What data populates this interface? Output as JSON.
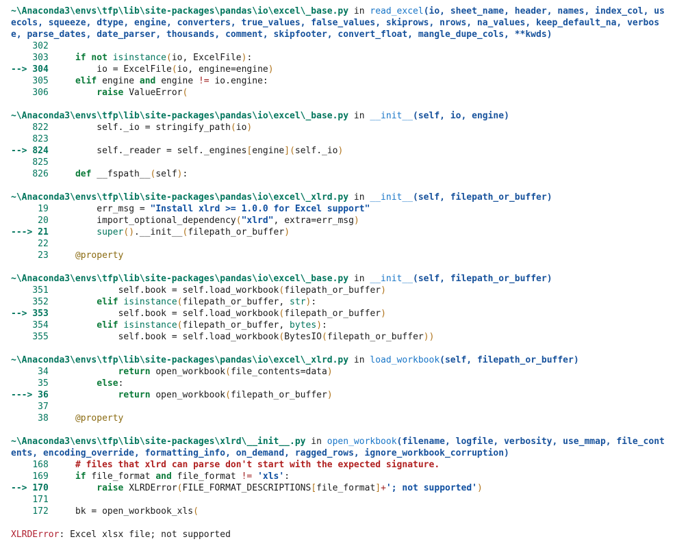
{
  "frames": [
    {
      "path": "~\\Anaconda3\\envs\\tfp\\lib\\site-packages\\pandas\\io\\excel\\_base.py",
      "in_word": "in",
      "func": "read_excel",
      "args": "(io, sheet_name, header, names, index_col, usecols, squeeze, dtype, engine, converters, true_values, false_values, skiprows, nrows, na_values, keep_default_na, verbose, parse_dates, date_parser, thousands, comment, skipfooter, convert_float, mangle_dupe_cols, **kwds)",
      "lines": [
        {
          "marker": "    ",
          "num": "302",
          "code": ""
        },
        {
          "marker": "    ",
          "num": "303",
          "code": "if not isinstance(io, ExcelFile):"
        },
        {
          "marker": "--> ",
          "num": "304",
          "code": "    io = ExcelFile(io, engine=engine)"
        },
        {
          "marker": "    ",
          "num": "305",
          "code": "elif engine and engine != io.engine:"
        },
        {
          "marker": "    ",
          "num": "306",
          "code": "    raise ValueError("
        }
      ]
    },
    {
      "path": "~\\Anaconda3\\envs\\tfp\\lib\\site-packages\\pandas\\io\\excel\\_base.py",
      "in_word": "in",
      "func": "__init__",
      "args": "(self, io, engine)",
      "lines": [
        {
          "marker": "    ",
          "num": "822",
          "code": "    self._io = stringify_path(io)"
        },
        {
          "marker": "    ",
          "num": "823",
          "code": ""
        },
        {
          "marker": "--> ",
          "num": "824",
          "code": "    self._reader = self._engines[engine](self._io)"
        },
        {
          "marker": "    ",
          "num": "825",
          "code": ""
        },
        {
          "marker": "    ",
          "num": "826",
          "code": "def __fspath__(self):"
        }
      ]
    },
    {
      "path": "~\\Anaconda3\\envs\\tfp\\lib\\site-packages\\pandas\\io\\excel\\_xlrd.py",
      "in_word": "in",
      "func": "__init__",
      "args": "(self, filepath_or_buffer)",
      "lines": [
        {
          "marker": "    ",
          "num": " 19",
          "code": "    err_msg = \"Install xlrd >= 1.0.0 for Excel support\""
        },
        {
          "marker": "    ",
          "num": " 20",
          "code": "    import_optional_dependency(\"xlrd\", extra=err_msg)"
        },
        {
          "marker": "---> ",
          "num": "21",
          "code": "    super().__init__(filepath_or_buffer)"
        },
        {
          "marker": "    ",
          "num": " 22",
          "code": ""
        },
        {
          "marker": "    ",
          "num": " 23",
          "code": "@property"
        }
      ]
    },
    {
      "path": "~\\Anaconda3\\envs\\tfp\\lib\\site-packages\\pandas\\io\\excel\\_base.py",
      "in_word": "in",
      "func": "__init__",
      "args": "(self, filepath_or_buffer)",
      "lines": [
        {
          "marker": "    ",
          "num": "351",
          "code": "        self.book = self.load_workbook(filepath_or_buffer)"
        },
        {
          "marker": "    ",
          "num": "352",
          "code": "    elif isinstance(filepath_or_buffer, str):"
        },
        {
          "marker": "--> ",
          "num": "353",
          "code": "        self.book = self.load_workbook(filepath_or_buffer)"
        },
        {
          "marker": "    ",
          "num": "354",
          "code": "    elif isinstance(filepath_or_buffer, bytes):"
        },
        {
          "marker": "    ",
          "num": "355",
          "code": "        self.book = self.load_workbook(BytesIO(filepath_or_buffer))"
        }
      ]
    },
    {
      "path": "~\\Anaconda3\\envs\\tfp\\lib\\site-packages\\pandas\\io\\excel\\_xlrd.py",
      "in_word": "in",
      "func": "load_workbook",
      "args": "(self, filepath_or_buffer)",
      "lines": [
        {
          "marker": "    ",
          "num": " 34",
          "code": "        return open_workbook(file_contents=data)"
        },
        {
          "marker": "    ",
          "num": " 35",
          "code": "    else:"
        },
        {
          "marker": "---> ",
          "num": "36",
          "code": "        return open_workbook(filepath_or_buffer)"
        },
        {
          "marker": "    ",
          "num": " 37",
          "code": ""
        },
        {
          "marker": "    ",
          "num": " 38",
          "code": "@property"
        }
      ]
    },
    {
      "path": "~\\Anaconda3\\envs\\tfp\\lib\\site-packages\\xlrd\\__init__.py",
      "in_word": "in",
      "func": "open_workbook",
      "args": "(filename, logfile, verbosity, use_mmap, file_contents, encoding_override, formatting_info, on_demand, ragged_rows, ignore_workbook_corruption)",
      "lines": [
        {
          "marker": "    ",
          "num": "168",
          "code": "# files that xlrd can parse don't start with the expected signature."
        },
        {
          "marker": "    ",
          "num": "169",
          "code": "if file_format and file_format != 'xls':"
        },
        {
          "marker": "--> ",
          "num": "170",
          "code": "    raise XLRDError(FILE_FORMAT_DESCRIPTIONS[file_format]+'; not supported')"
        },
        {
          "marker": "    ",
          "num": "171",
          "code": ""
        },
        {
          "marker": "    ",
          "num": "172",
          "code": "bk = open_workbook_xls("
        }
      ]
    }
  ],
  "error": {
    "name": "XLRDError",
    "message": ": Excel xlsx file; not supported"
  },
  "colors": {
    "path": "#00755c",
    "function": "#1976c8",
    "args": "#17529c",
    "keyword": "#0a7a38",
    "string": "#0f4fa0",
    "comment": "#b02020",
    "error": "#b02030"
  }
}
